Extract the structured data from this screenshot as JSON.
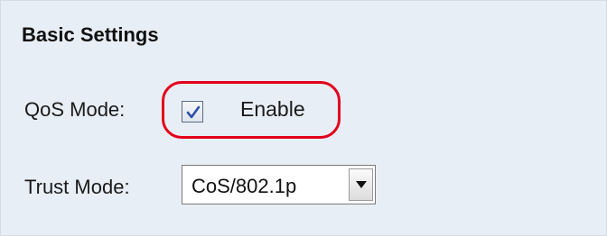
{
  "section": {
    "title": "Basic Settings"
  },
  "qos_mode": {
    "label": "QoS Mode:",
    "checkbox_checked": true,
    "checkbox_label": "Enable",
    "highlight_color": "#e3001b"
  },
  "trust_mode": {
    "label": "Trust Mode:",
    "selected": "CoS/802.1p"
  },
  "colors": {
    "panel_background": "#e8eef5",
    "checkmark": "#2b4fa8"
  }
}
